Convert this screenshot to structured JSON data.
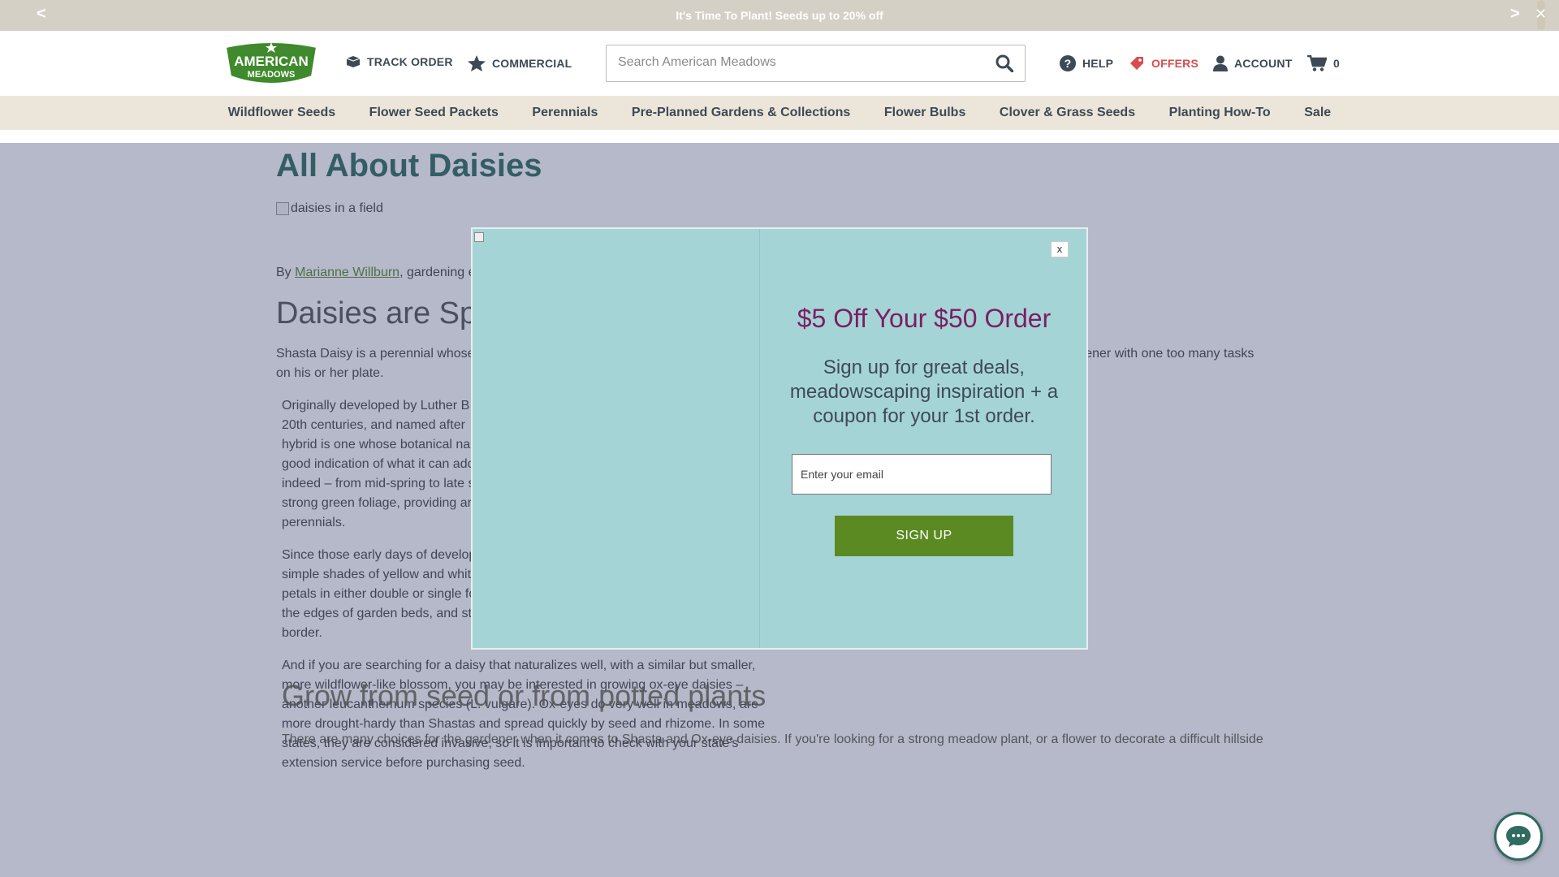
{
  "promo": {
    "message": "It's Time To Plant! Seeds up to 20% off",
    "prev": "<",
    "next": ">",
    "close": "✕"
  },
  "header": {
    "logo_text_top": "AMERICAN",
    "logo_text_bottom": "MEADOWS",
    "track_order": "TRACK ORDER",
    "commercial": "COMMERCIAL",
    "search_placeholder": "Search American Meadows",
    "help": "HELP",
    "offers": "OFFERS",
    "account": "ACCOUNT",
    "cart_count": "0",
    "offers_color": "#d94d4d"
  },
  "nav": {
    "items": [
      "Wildflower Seeds",
      "Flower Seed Packets",
      "Perennials",
      "Pre-Planned Gardens & Collections",
      "Flower Bulbs",
      "Clover & Grass Seeds",
      "Planting How-To",
      "Sale"
    ]
  },
  "article": {
    "title": "All About Daisies",
    "hero_alt": "daisies in a field",
    "byline_prefix": "By ",
    "author": "Marianne Willburn",
    "byline_suffix": ", gardening e",
    "heading1": "Daisies are Sp",
    "p1_left": "Shasta Daisy is a perennial whose",
    "p1_right": "rdener with one too many tasks",
    "p1_line2": "on his or her plate.",
    "p2": [
      "Originally developed by Luther B",
      "20th centuries, and named after",
      "hybrid is one whose botanical na",
      "good indication of what it can adc",
      "indeed – from mid-spring to late s",
      "strong green foliage, providing ar",
      "perennials."
    ],
    "p3": [
      "Since those early days of develop",
      "simple shades of yellow and whit",
      "petals in either double or single fo",
      "the edges of garden beds, and st",
      "border."
    ],
    "p4": [
      "And if you are searching for a daisy that naturalizes well, with a similar but smaller,",
      "more wildflower-like blossom, you may be interested in growing ox-eye daisies –",
      "another leucanthemum species (L. vulgare). Ox-eyes do very well in meadows, are",
      "more drought-hardy than Shastas and spread quickly by seed and rhizome. In some",
      "states, they are considered invasive, so it is important to check with your state's",
      "extension service before purchasing seed."
    ],
    "heading2": "Grow from seed or from potted plants",
    "p5": "There are many choices for the gardener when it comes to Shasta and Ox-eye daisies. If you're looking for a strong meadow plant, or a flower to decorate a difficult hillside"
  },
  "modal": {
    "close": "x",
    "offer": "$5 Off Your $50 Order",
    "subtext": "Sign up for great deals, meadowscaping inspiration + a coupon for your 1st order.",
    "email_placeholder": "Enter your email",
    "button": "SIGN UP"
  },
  "colors": {
    "brand_green": "#2f6b5e",
    "button_green": "#5a8a21",
    "offer_purple": "#7a1e63",
    "modal_bg": "#a5d4d7"
  }
}
